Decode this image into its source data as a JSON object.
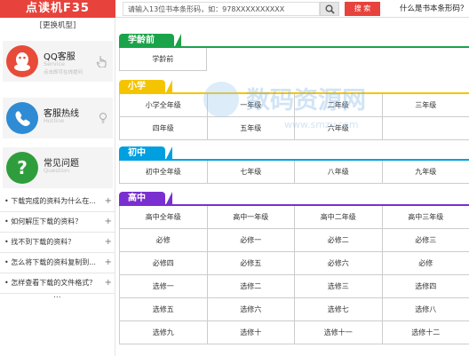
{
  "header": {
    "brand": "点读机F35",
    "search_placeholder": "请输入13位书本条形码，如：978XXXXXXXXXX",
    "search_button": "搜 索",
    "help_link": "什么是书本条形码？"
  },
  "sidebar": {
    "change_model": "[更换机型]",
    "services": [
      {
        "title": "QQ客服",
        "sub": "Service",
        "note": "点击即可在线提问"
      },
      {
        "title": "客服热线",
        "sub": "Hotline"
      },
      {
        "title": "常见问题",
        "sub": "Question"
      }
    ],
    "faq": [
      "下载完成的资料为什么在...",
      "如何解压下载的资料？",
      "找不到下载的资料？",
      "怎么将下载的资料复制到...",
      "怎样查看下载的文件格式？"
    ],
    "faq_more": "..."
  },
  "colors": {
    "brand": "#e7423c",
    "preschool": "#1aa34a",
    "primary": "#f5c400",
    "junior": "#00a0e0",
    "senior": "#7a2fd0"
  },
  "sections": {
    "preschool": {
      "title": "学龄前",
      "items": [
        "学龄前"
      ]
    },
    "primary": {
      "title": "小学",
      "items": [
        "小学全年级",
        "一年级",
        "二年级",
        "三年级",
        "四年级",
        "五年级",
        "六年级",
        ""
      ]
    },
    "junior": {
      "title": "初中",
      "items": [
        "初中全年级",
        "七年级",
        "八年级",
        "九年级"
      ]
    },
    "senior": {
      "title": "高中",
      "items": [
        "高中全年级",
        "高中一年级",
        "高中二年级",
        "高中三年级",
        "必修",
        "必修一",
        "必修二",
        "必修三",
        "必修四",
        "必修五",
        "必修六",
        "必修",
        "选修一",
        "选修二",
        "选修三",
        "选修四",
        "选修五",
        "选修六",
        "选修七",
        "选修八",
        "选修九",
        "选修十",
        "选修十一",
        "选修十二"
      ]
    }
  },
  "watermark": {
    "text": "数码资源网",
    "url": "www.smzy.com"
  }
}
